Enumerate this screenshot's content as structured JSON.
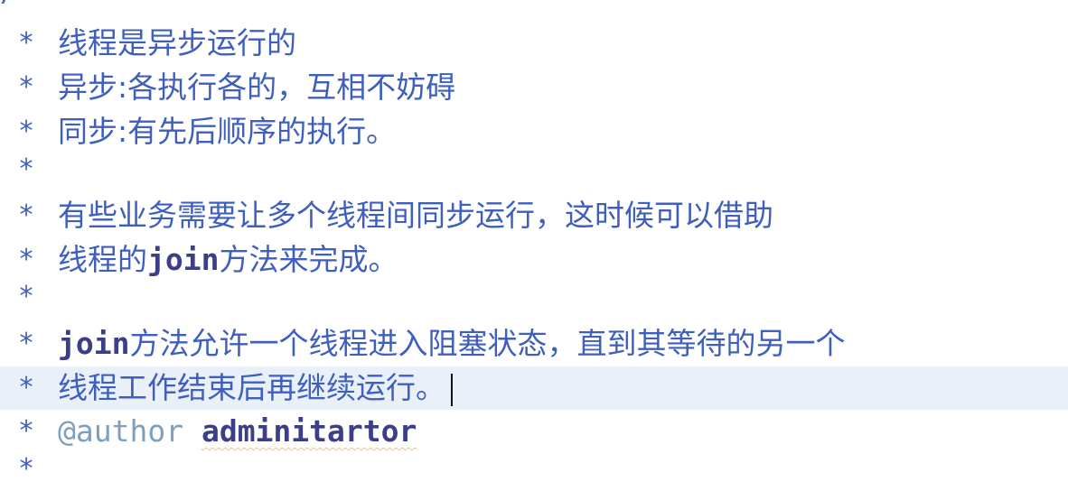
{
  "editor": {
    "comment_open": "/**",
    "star": "*",
    "lines": [
      {
        "text": "线程是异步运行的"
      },
      {
        "text": "异步:各执行各的，互相不妨碍"
      },
      {
        "text": "同步:有先后顺序的执行。"
      },
      {
        "text": ""
      },
      {
        "text": "有些业务需要让多个线程间同步运行，这时候可以借助"
      },
      {
        "pre": "线程的",
        "kw": "join",
        "post": "方法来完成。"
      },
      {
        "text": ""
      },
      {
        "kw": "join",
        "post": "方法允许一个线程进入阻塞状态，直到其等待的另一个"
      },
      {
        "text": "线程工作结束后再继续运行。"
      },
      {
        "tag": "@author",
        "name": "adminitartor"
      },
      {
        "text": ""
      }
    ]
  },
  "colors": {
    "javadoc": "#3f5fbf",
    "keyword": "#3b3f8a",
    "tag": "#7f9fbf",
    "current_line": "#e9f0f8"
  }
}
